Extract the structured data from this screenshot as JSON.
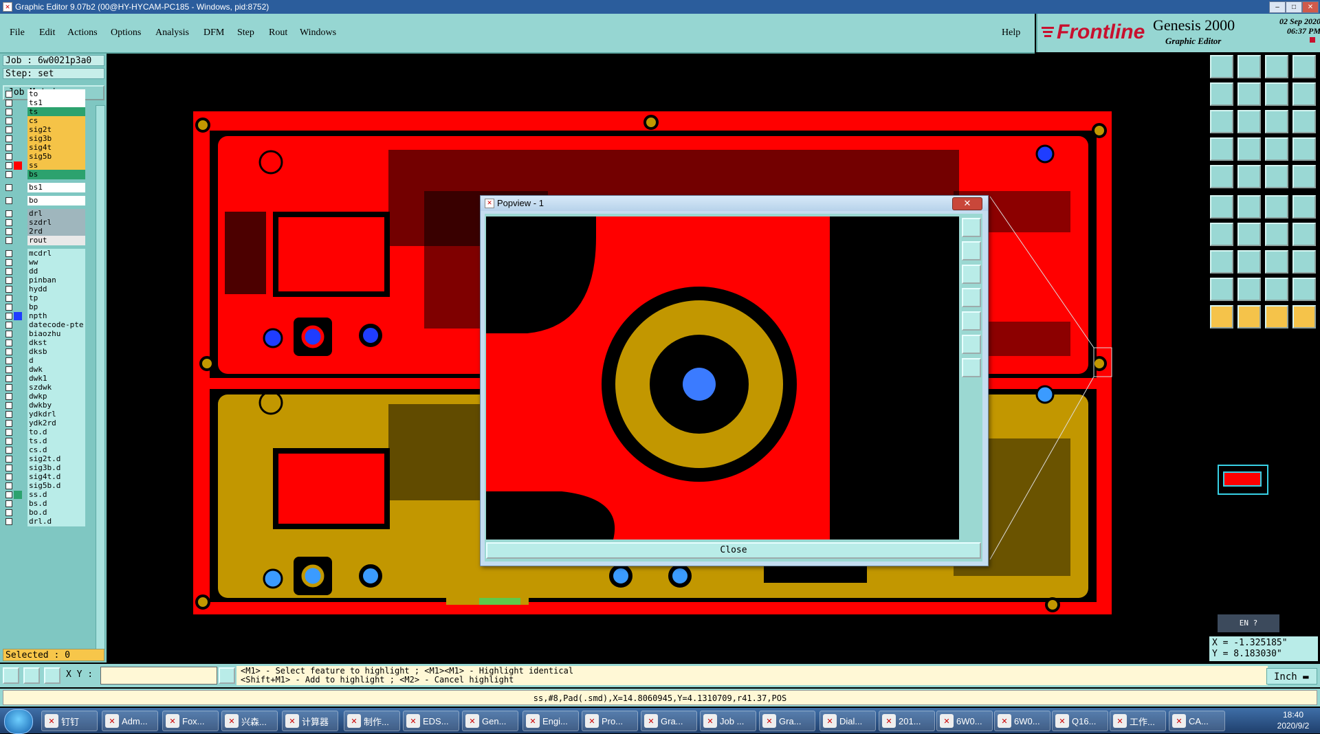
{
  "titlebar": {
    "title": "Graphic Editor 9.07b2 (00@HY-HYCAM-PC185 - Windows, pid:8752)",
    "min": "–",
    "max": "□",
    "close": "✕"
  },
  "menu": [
    "File",
    "Edit",
    "Actions",
    "Options",
    "Analysis",
    "DFM",
    "Step",
    "Rout",
    "Windows"
  ],
  "help": "Help",
  "brand": {
    "logo": "Frontline",
    "product": "Genesis 2000",
    "subtitle": "Graphic Editor",
    "date": "02 Sep 2020",
    "time": "06:37 PM"
  },
  "job": {
    "job_label": "Job : 6w0021p3a0",
    "step_label": "Step: set",
    "matrix_button": "Job Matrix ..."
  },
  "layers": [
    {
      "name": "to",
      "color": "#ffffff"
    },
    {
      "name": "ts1",
      "color": "#ffffff"
    },
    {
      "name": "ts",
      "color": "#2ca26e"
    },
    {
      "name": "cs",
      "color": "#f5c347"
    },
    {
      "name": "sig2t",
      "color": "#f5c347"
    },
    {
      "name": "sig3b",
      "color": "#f5c347"
    },
    {
      "name": "sig4t",
      "color": "#f5c347"
    },
    {
      "name": "sig5b",
      "color": "#f5c347"
    },
    {
      "name": "ss",
      "color": "#f5c347",
      "swatch": "#ff0000"
    },
    {
      "name": "bs",
      "color": "#2ca26e"
    },
    {
      "name": "bs1",
      "color": "#ffffff"
    },
    {
      "name": "bo",
      "color": "#ffffff"
    },
    {
      "name": "drl",
      "color": "#9fb6bd"
    },
    {
      "name": "szdrl",
      "color": "#9fb6bd"
    },
    {
      "name": "2rd",
      "color": "#9fb6bd"
    },
    {
      "name": "rout",
      "color": "#e9e9e9"
    },
    {
      "name": "mcdrl",
      "color": "#b9ece8"
    },
    {
      "name": "ww",
      "color": "#b9ece8"
    },
    {
      "name": "dd",
      "color": "#b9ece8"
    },
    {
      "name": "pinban",
      "color": "#b9ece8"
    },
    {
      "name": "hydd",
      "color": "#b9ece8"
    },
    {
      "name": "tp",
      "color": "#b9ece8"
    },
    {
      "name": "bp",
      "color": "#b9ece8"
    },
    {
      "name": "npth",
      "color": "#b9ece8",
      "swatch": "#1f3dff"
    },
    {
      "name": "datecode-pte",
      "color": "#b9ece8"
    },
    {
      "name": "biaozhu",
      "color": "#b9ece8"
    },
    {
      "name": "dkst",
      "color": "#b9ece8"
    },
    {
      "name": "dksb",
      "color": "#b9ece8"
    },
    {
      "name": "d",
      "color": "#b9ece8"
    },
    {
      "name": "dwk",
      "color": "#b9ece8"
    },
    {
      "name": "dwk1",
      "color": "#b9ece8"
    },
    {
      "name": "szdwk",
      "color": "#b9ece8"
    },
    {
      "name": "dwkp",
      "color": "#b9ece8"
    },
    {
      "name": "dwkby",
      "color": "#b9ece8"
    },
    {
      "name": "ydkdrl",
      "color": "#b9ece8"
    },
    {
      "name": "ydk2rd",
      "color": "#b9ece8"
    },
    {
      "name": "to.d",
      "color": "#b9ece8"
    },
    {
      "name": "ts.d",
      "color": "#b9ece8"
    },
    {
      "name": "cs.d",
      "color": "#b9ece8"
    },
    {
      "name": "sig2t.d",
      "color": "#b9ece8"
    },
    {
      "name": "sig3b.d",
      "color": "#b9ece8"
    },
    {
      "name": "sig4t.d",
      "color": "#b9ece8"
    },
    {
      "name": "sig5b.d",
      "color": "#b9ece8"
    },
    {
      "name": "ss.d",
      "color": "#b9ece8",
      "swatch": "#2ca26e"
    },
    {
      "name": "bs.d",
      "color": "#b9ece8"
    },
    {
      "name": "bo.d",
      "color": "#b9ece8"
    },
    {
      "name": "drl.d",
      "color": "#b9ece8"
    }
  ],
  "selected": "Selected : 0",
  "xy_label": "X Y :",
  "xy_value": "",
  "hint_line1": "<M1> - Select feature to highlight ; <M1><M1> - Highlight identical",
  "hint_line2": "<Shift+M1> - Add to highlight ; <M2> - Cancel highlight",
  "unit": "Inch",
  "status": "ss,#8,Pad(.smd),X=14.8060945,Y=4.1310709,r41.37,POS",
  "coords": {
    "x": "X = -1.325185\"",
    "y": "Y = 8.183030\""
  },
  "ime": "EN",
  "popview": {
    "title": "Popview - 1",
    "close_label": "Close"
  },
  "taskbar": {
    "items": [
      "钉钉",
      "Adm...",
      "Fox...",
      "兴森...",
      "计算器",
      "制作...",
      "EDS...",
      "Gen...",
      "Engi...",
      "Pro...",
      "Gra...",
      "Job ...",
      "Gra...",
      "Dial...",
      "201...",
      "6W0...",
      "6W0...",
      "Q16...",
      "工作...",
      "CA..."
    ],
    "clock_time": "18:40",
    "clock_date": "2020/9/2"
  },
  "colors": {
    "copper": "#ff0000",
    "copper_bottom": "#c29700",
    "pad_hole": "#3b7bff",
    "panel": "#96d6d2"
  }
}
